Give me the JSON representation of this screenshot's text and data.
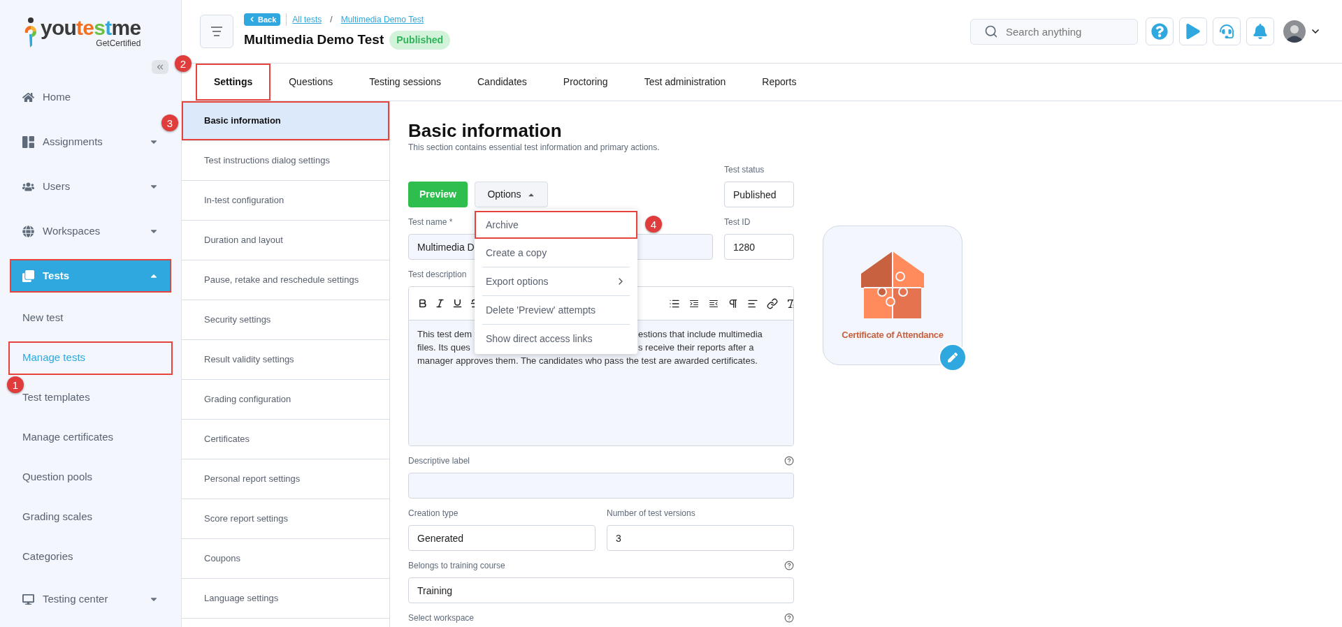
{
  "logo": {
    "parts": [
      {
        "text": "you",
        "color": "#3a3a3a"
      },
      {
        "text": "te",
        "color": "#f37021"
      },
      {
        "text": "s",
        "color": "#6cbf43"
      },
      {
        "text": "t",
        "color": "#2ea8df"
      },
      {
        "text": "me",
        "color": "#3a3a3a"
      }
    ],
    "tagline": "GetCertified"
  },
  "sidebar": {
    "items": [
      {
        "label": "Home",
        "kind": "link",
        "selected": false,
        "highlighted": false
      },
      {
        "label": "Assignments",
        "kind": "group",
        "expanded": false,
        "selected": false,
        "highlighted": false
      },
      {
        "label": "Users",
        "kind": "group",
        "expanded": false,
        "selected": false,
        "highlighted": false
      },
      {
        "label": "Workspaces",
        "kind": "group",
        "expanded": false,
        "selected": false,
        "highlighted": false
      },
      {
        "label": "Tests",
        "kind": "group",
        "expanded": true,
        "selected": true,
        "highlighted": true,
        "children": [
          {
            "label": "New test",
            "selected": false,
            "highlighted": false
          },
          {
            "label": "Manage tests",
            "selected": true,
            "highlighted": true,
            "marker": "1"
          },
          {
            "label": "Test templates",
            "selected": false,
            "highlighted": false
          },
          {
            "label": "Manage certificates",
            "selected": false,
            "highlighted": false
          },
          {
            "label": "Question pools",
            "selected": false,
            "highlighted": false
          },
          {
            "label": "Grading scales",
            "selected": false,
            "highlighted": false
          },
          {
            "label": "Categories",
            "selected": false,
            "highlighted": false
          }
        ]
      },
      {
        "label": "Testing center",
        "kind": "group",
        "expanded": false,
        "selected": false,
        "highlighted": false
      }
    ]
  },
  "header": {
    "back": "Back",
    "breadcrumb": [
      "All tests",
      "Multimedia Demo Test"
    ],
    "separator": "/",
    "title": "Multimedia Demo Test",
    "status": "Published",
    "search": {
      "placeholder": "Search anything"
    }
  },
  "tabs": [
    {
      "label": "Settings",
      "selected": true,
      "highlighted": true,
      "marker": "2"
    },
    {
      "label": "Questions",
      "selected": false,
      "highlighted": false
    },
    {
      "label": "Testing sessions",
      "selected": false,
      "highlighted": false
    },
    {
      "label": "Candidates",
      "selected": false,
      "highlighted": false
    },
    {
      "label": "Proctoring",
      "selected": false,
      "highlighted": false
    },
    {
      "label": "Test administration",
      "selected": false,
      "highlighted": false
    },
    {
      "label": "Reports",
      "selected": false,
      "highlighted": false
    }
  ],
  "settings_nav": [
    {
      "label": "Basic information",
      "selected": true,
      "highlighted": true,
      "marker": "3"
    },
    {
      "label": "Test instructions dialog settings",
      "selected": false,
      "highlighted": false
    },
    {
      "label": "In-test configuration",
      "selected": false,
      "highlighted": false
    },
    {
      "label": "Duration and layout",
      "selected": false,
      "highlighted": false
    },
    {
      "label": "Pause, retake and reschedule settings",
      "selected": false,
      "highlighted": false
    },
    {
      "label": "Security settings",
      "selected": false,
      "highlighted": false
    },
    {
      "label": "Result validity settings",
      "selected": false,
      "highlighted": false
    },
    {
      "label": "Grading configuration",
      "selected": false,
      "highlighted": false
    },
    {
      "label": "Certificates",
      "selected": false,
      "highlighted": false
    },
    {
      "label": "Personal report settings",
      "selected": false,
      "highlighted": false
    },
    {
      "label": "Score report settings",
      "selected": false,
      "highlighted": false
    },
    {
      "label": "Coupons",
      "selected": false,
      "highlighted": false
    },
    {
      "label": "Language settings",
      "selected": false,
      "highlighted": false
    }
  ],
  "content": {
    "heading": "Basic information",
    "subtitle": "This section contains essential test information and primary actions.",
    "preview": "Preview",
    "options": {
      "label": "Options",
      "expanded": true,
      "menu": [
        {
          "label": "Archive",
          "submenu": false,
          "highlighted": true,
          "marker": "4"
        },
        {
          "label": "Create a copy",
          "submenu": false,
          "highlighted": false
        },
        {
          "label": "Export options",
          "submenu": true,
          "highlighted": false
        },
        {
          "label": "Delete 'Preview' attempts",
          "submenu": false,
          "highlighted": false
        },
        {
          "label": "Show direct access links",
          "submenu": false,
          "highlighted": false
        }
      ]
    },
    "test_status": {
      "label": "Test status",
      "value": "Published"
    },
    "test_name": {
      "label": "Test name *",
      "value": "Multimedia D"
    },
    "test_id": {
      "label": "Test ID",
      "value": "1280"
    },
    "description": {
      "label": "Test description",
      "lines": [
        {
          "left": "This test dem",
          "right": "estions that include multimedia"
        },
        {
          "left": "files. Its ques",
          "right": "s receive their reports after a"
        },
        {
          "left": "manager approves them. The candidates who pass the test are awarded certificates."
        }
      ]
    },
    "descriptive_label": {
      "label": "Descriptive label",
      "help": true
    },
    "creation_type": {
      "label": "Creation type",
      "value": "Generated"
    },
    "versions": {
      "label": "Number of test versions",
      "value": "3"
    },
    "training_course": {
      "label": "Belongs to training course",
      "value": "Training",
      "help": true
    },
    "workspace": {
      "label": "Select workspace",
      "help": true
    }
  },
  "certificate": {
    "title": "Certificate of Attendance"
  }
}
